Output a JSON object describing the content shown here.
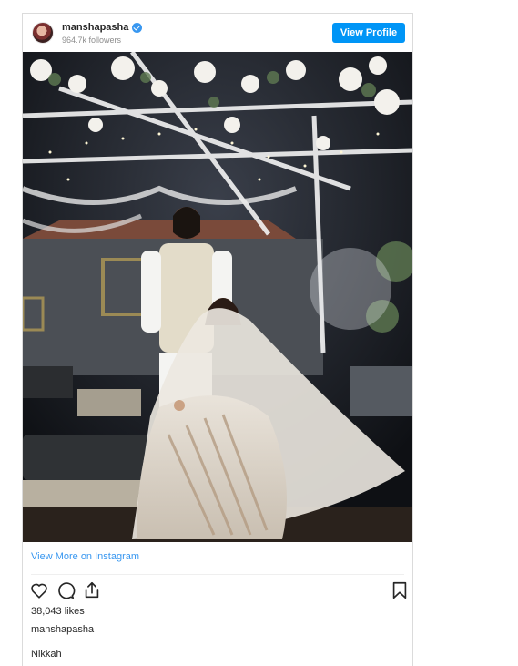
{
  "post": {
    "username": "manshapasha",
    "followers": "964.7k followers",
    "view_profile_label": "View Profile",
    "view_more_label": "View More on Instagram",
    "likes": "38,043 likes",
    "caption_user": "manshapasha",
    "caption": "Nikkah"
  },
  "icons": [
    "heart-icon",
    "comment-icon",
    "share-icon",
    "bookmark-icon",
    "verified-icon"
  ],
  "colors": {
    "accent": "#0095f6",
    "link": "#3897f0",
    "border": "#dbdbdb"
  }
}
